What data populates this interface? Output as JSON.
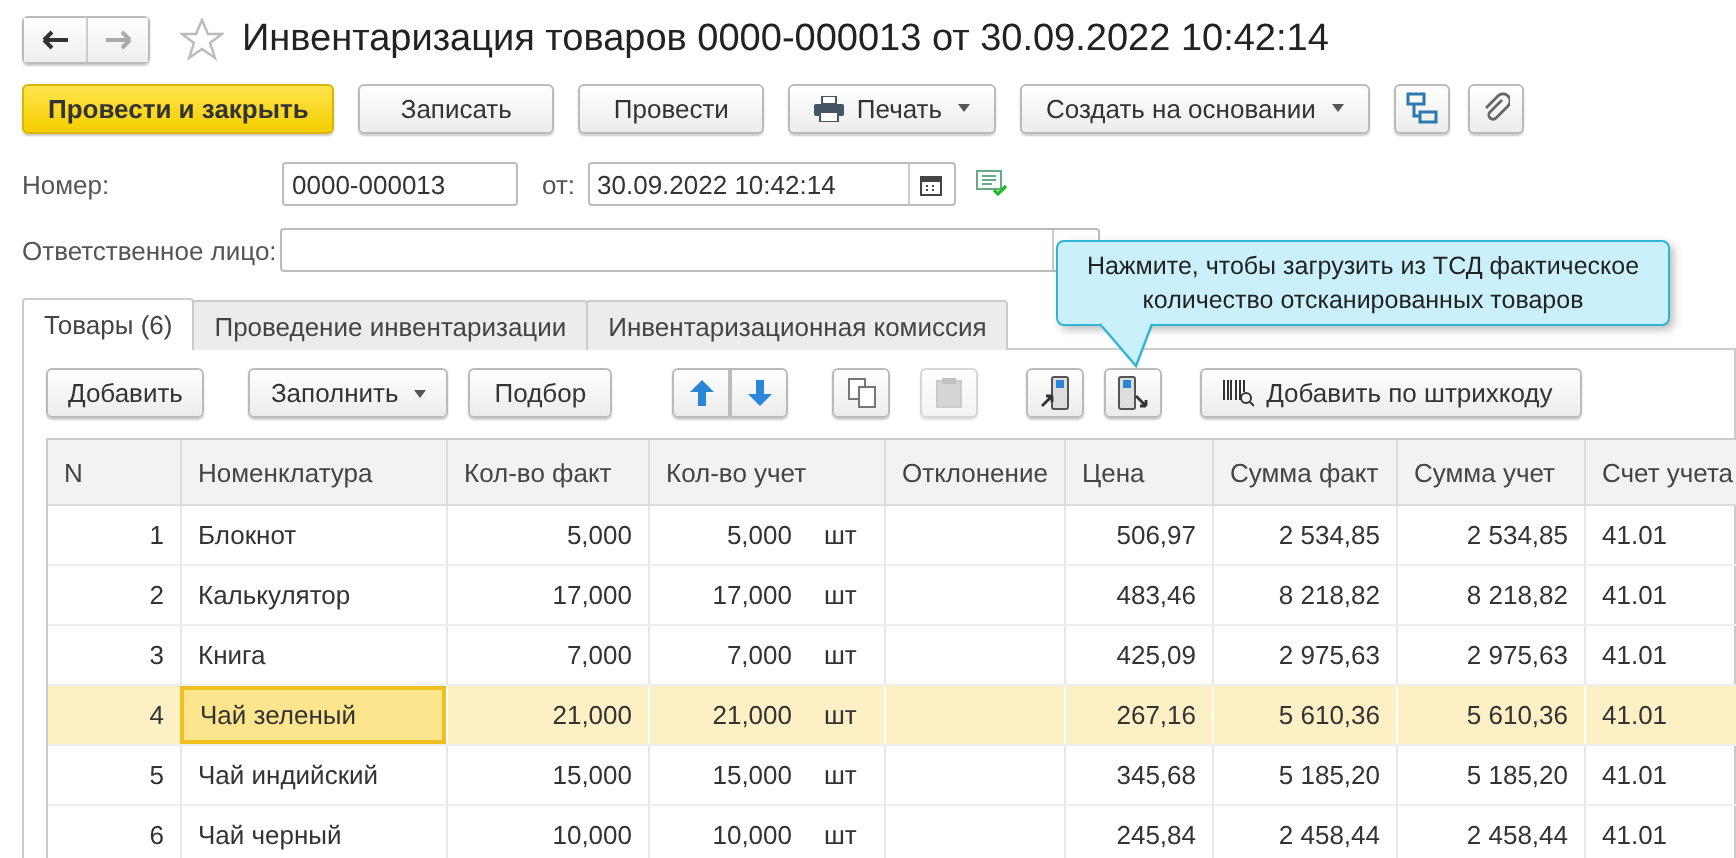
{
  "window": {
    "title": "Инвентаризация товаров 0000-000013 от 30.09.2022 10:42:14",
    "favorite": false
  },
  "toolbar": [
    {
      "kind": "primary",
      "label": "Провести и закрыть"
    },
    {
      "kind": "plain",
      "label": "Записать"
    },
    {
      "kind": "plain",
      "label": "Провести"
    },
    {
      "kind": "print",
      "label": "Печать"
    },
    {
      "kind": "menu",
      "label": "Создать на основании"
    },
    {
      "kind": "structure"
    },
    {
      "kind": "attach"
    }
  ],
  "number": {
    "label": "Номер:",
    "value": "0000-000013",
    "date_label": "от:",
    "date": "30.09.2022 10:42:14"
  },
  "responsible": {
    "label": "Ответственное лицо:"
  },
  "tooltip": "Нажмите, чтобы загрузить из ТСД фактическое количество отсканированных товаров",
  "tabs": [
    {
      "label": "Товары (6)",
      "selected": true
    },
    {
      "label": "Проведение инвентаризации",
      "selected": false
    },
    {
      "label": "Инвентаризационная комиссия",
      "selected": false
    }
  ],
  "table_toolbar": [
    {
      "kind": "plain",
      "label": "Добавить"
    },
    {
      "kind": "menu",
      "label": "Заполнить"
    },
    {
      "kind": "plain",
      "label": "Подбор"
    },
    {
      "kind": "up"
    },
    {
      "kind": "down"
    },
    {
      "kind": "copy",
      "disabled": false
    },
    {
      "kind": "paste",
      "disabled": true
    },
    {
      "kind": "upload"
    },
    {
      "kind": "download"
    },
    {
      "kind": "barcode",
      "label": "Добавить по штрихкоду"
    }
  ],
  "table": {
    "columns": [
      "N",
      "Номенклатура",
      "Кол-во факт",
      "Кол-во учет",
      "Отклонение",
      "Цена",
      "Сумма факт",
      "Сумма учет",
      "Счет учета"
    ],
    "rows": [
      {
        "n": "1",
        "name": "Блокнот",
        "fact": "5,000",
        "account": "5,000",
        "unit": "шт",
        "price": "506,97",
        "sum_fact": "2 534,85",
        "sum_account": "2 534,85",
        "acc": "41.01",
        "selected": false
      },
      {
        "n": "2",
        "name": "Калькулятор",
        "fact": "17,000",
        "account": "17,000",
        "unit": "шт",
        "price": "483,46",
        "sum_fact": "8 218,82",
        "sum_account": "8 218,82",
        "acc": "41.01",
        "selected": false
      },
      {
        "n": "3",
        "name": "Книга",
        "fact": "7,000",
        "account": "7,000",
        "unit": "шт",
        "price": "425,09",
        "sum_fact": "2 975,63",
        "sum_account": "2 975,63",
        "acc": "41.01",
        "selected": false
      },
      {
        "n": "4",
        "name": "Чай зеленый",
        "fact": "21,000",
        "account": "21,000",
        "unit": "шт",
        "price": "267,16",
        "sum_fact": "5 610,36",
        "sum_account": "5 610,36",
        "acc": "41.01",
        "selected": true
      },
      {
        "n": "5",
        "name": "Чай индийский",
        "fact": "15,000",
        "account": "15,000",
        "unit": "шт",
        "price": "345,68",
        "sum_fact": "5 185,20",
        "sum_account": "5 185,20",
        "acc": "41.01",
        "selected": false
      },
      {
        "n": "6",
        "name": "Чай черный",
        "fact": "10,000",
        "account": "10,000",
        "unit": "шт",
        "price": "245,84",
        "sum_fact": "2 458,44",
        "sum_account": "2 458,44",
        "acc": "41.01",
        "selected": false
      }
    ]
  }
}
